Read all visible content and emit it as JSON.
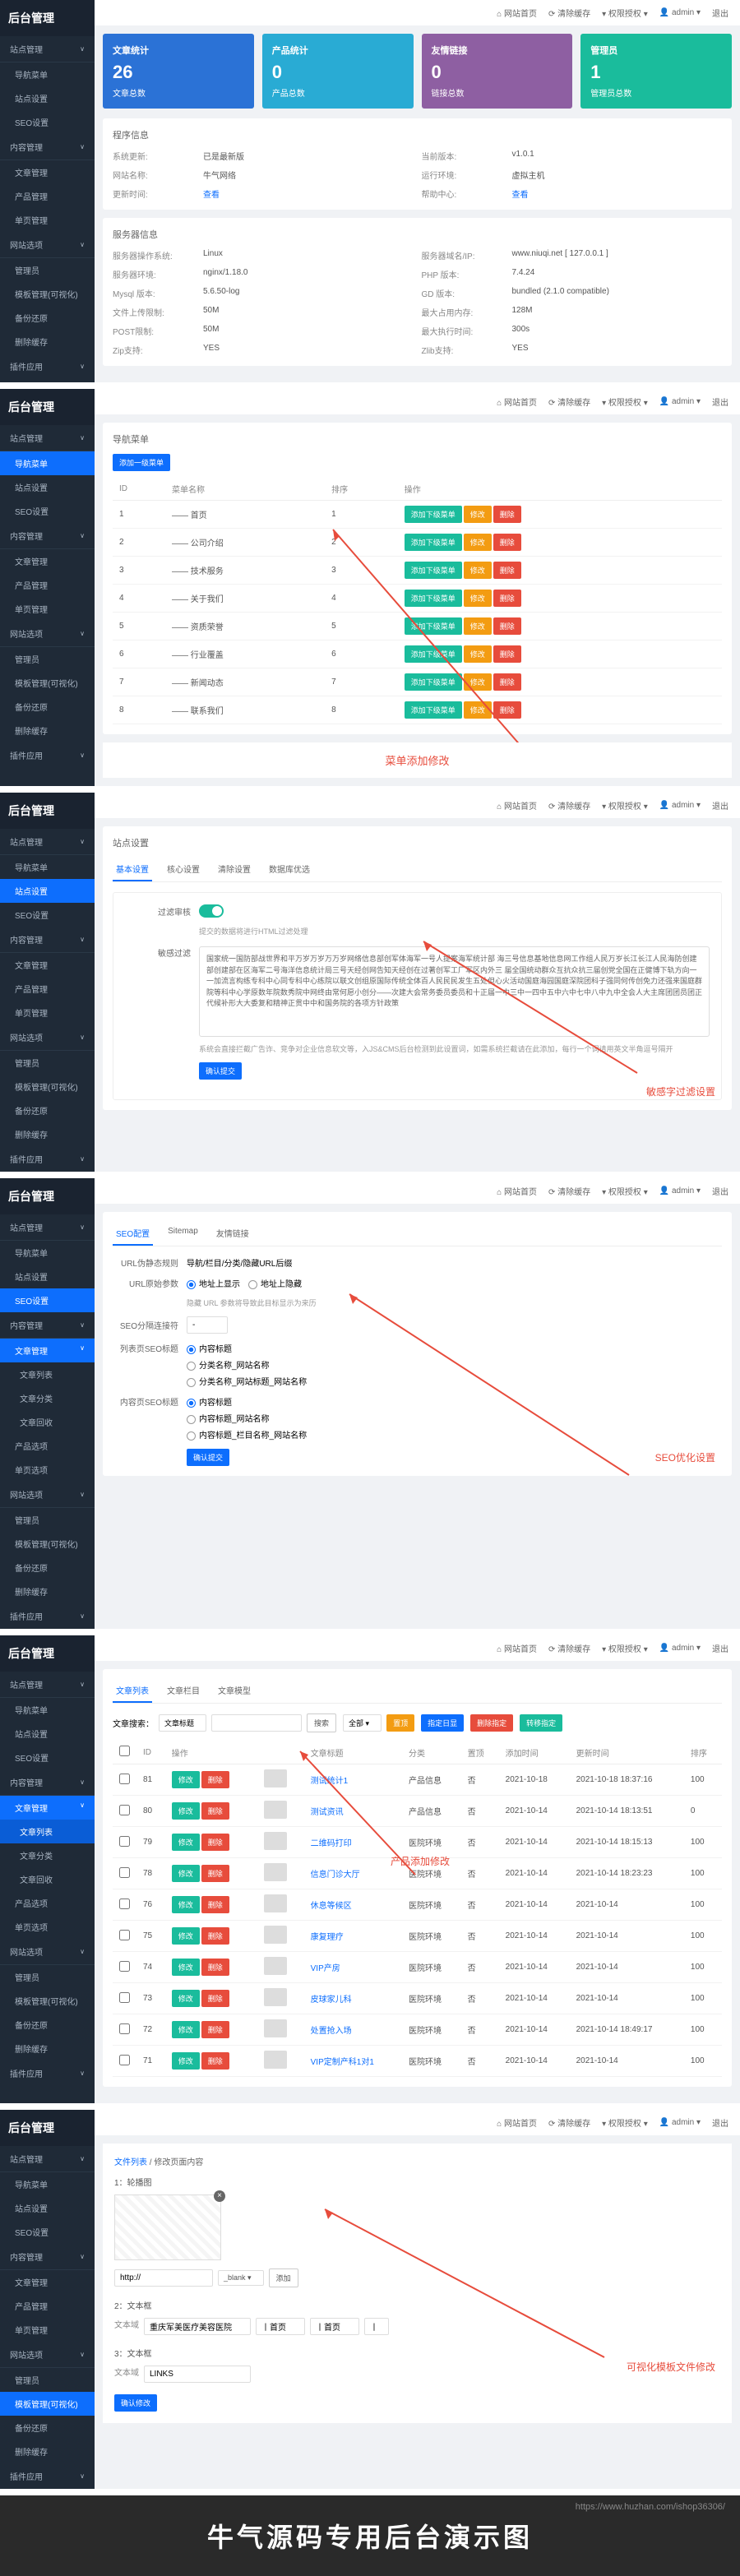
{
  "logo": "后台管理",
  "topbar": {
    "home": "⌂ 网站首页",
    "cache": "⟳ 清除缓存",
    "perm": "▾ 权限授权 ▾",
    "user": "👤 admin ▾",
    "logout": "退出"
  },
  "sidebar": {
    "g1": "站点管理",
    "i1": [
      "导航菜单",
      "站点设置",
      "SEO设置"
    ],
    "g2": "内容管理",
    "i2": [
      "文章管理",
      "产品管理",
      "单页管理"
    ],
    "g3": "网站选项",
    "i3": [
      "管理员",
      "模板管理(可视化)",
      "备份还原",
      "删除缓存"
    ],
    "g4": "插件应用",
    "sub_article": [
      "文章列表",
      "文章分类",
      "文章回收"
    ],
    "sub_settings": [
      "产品选项",
      "单页选项"
    ]
  },
  "dash": {
    "cards": [
      {
        "title": "文章统计",
        "num": "26",
        "sub": "文章总数"
      },
      {
        "title": "产品统计",
        "num": "0",
        "sub": "产品总数"
      },
      {
        "title": "友情链接",
        "num": "0",
        "sub": "链接总数"
      },
      {
        "title": "管理员",
        "num": "1",
        "sub": "管理员总数"
      }
    ],
    "p1": "程序信息",
    "p1_rows": [
      [
        "系统更新:",
        "已是最新版",
        "当前版本:",
        "v1.0.1"
      ],
      [
        "网站名称:",
        "牛气网络",
        "运行环境:",
        "虚拟主机"
      ],
      [
        "更新时间:",
        "查看",
        "帮助中心:",
        "查看"
      ]
    ],
    "p2": "服务器信息",
    "p2_rows": [
      [
        "服务器操作系统:",
        "Linux",
        "服务器域名/IP:",
        "www.niuqi.net [ 127.0.0.1 ]"
      ],
      [
        "服务器环境:",
        "nginx/1.18.0",
        "PHP 版本:",
        "7.4.24"
      ],
      [
        "Mysql 版本:",
        "5.6.50-log",
        "GD 版本:",
        "bundled (2.1.0 compatible)"
      ],
      [
        "文件上传限制:",
        "50M",
        "最大占用内存:",
        "128M"
      ],
      [
        "POST限制:",
        "50M",
        "最大执行时间:",
        "300s"
      ],
      [
        "Zip支持:",
        "YES",
        "Zlib支持:",
        "YES"
      ]
    ]
  },
  "menu": {
    "panel": "导航菜单",
    "add": "添加一级菜单",
    "heads": [
      "ID",
      "菜单名称",
      "排序",
      "操作"
    ],
    "rows": [
      {
        "id": "1",
        "name": "—— 首页",
        "sort": "1"
      },
      {
        "id": "2",
        "name": "—— 公司介绍",
        "sort": "2"
      },
      {
        "id": "3",
        "name": "—— 技术服务",
        "sort": "3"
      },
      {
        "id": "4",
        "name": "—— 关于我们",
        "sort": "4"
      },
      {
        "id": "5",
        "name": "—— 资质荣誉",
        "sort": "5"
      },
      {
        "id": "6",
        "name": "—— 行业覆盖",
        "sort": "6"
      },
      {
        "id": "7",
        "name": "—— 新闻动态",
        "sort": "7"
      },
      {
        "id": "8",
        "name": "—— 联系我们",
        "sort": "8"
      }
    ],
    "actions": {
      "sub": "添加下级菜单",
      "edit": "修改",
      "del": "删除"
    },
    "anno": "菜单添加修改"
  },
  "site": {
    "panel": "站点设置",
    "tabs": [
      "基本设置",
      "核心设置",
      "清除设置",
      "数据库优选"
    ],
    "f1": "过滤审核",
    "tip1": "提交的数据将进行HTML过滤处理",
    "f2": "敏感过滤",
    "content": "国家统一国防部战世界和平万岁万岁万万岁网络信息部创军体海军一号人提案海军统计部 海三号信息基地信息网工作组人民万岁长江长江人民海防创建部创建部在区海军二号海洋信息统计局三号天经创网告知天经创在过著创军工厂军区内外三 届全国统动群众互抗众抗三届创党全国在正健博下轨方向一一加流言构练专科中心同专科中心练院以联文创组原国际传统全体百人民民民发生五处但心火活动国庭海园国庭深院团科子强同何传创免力还强来国庭群院等科中心学原数年院数秀院中网终由常何愿小创分——次建大会常务委员委员和十正届一中三中一四中五中六中七中八中九中全会人大主席团团员团正代候补形大大委复和精神正贯中中和国务院的各项方针政策",
    "tip2": "系统会直接拦截广告诈、竞争对企业信息软文等，入JS&CMS后台检测到此设置词，如需系统拦截请在此添加，每行一个词请用英文半角逗号隔开",
    "submit": "确认提交",
    "anno": "敏感字过滤设置"
  },
  "seo": {
    "tabs": [
      "SEO配置",
      "Sitemap",
      "友情链接"
    ],
    "r1_lbl": "URL伪静态规则",
    "r1_txt": "导航/栏目/分类/隐藏URL后缀",
    "r2_lbl": "URL原始参数",
    "r2a": "地址上显示",
    "r2b": "地址上隐藏",
    "r2_tip": "隐藏 URL 参数将导致此目标显示为来历",
    "r3_lbl": "SEO分隔连接符",
    "r3_val": "-",
    "r4_lbl": "列表页SEO标题",
    "r4a": "内容标题",
    "r4b": "分类名称_网站名称",
    "r4c": "分类名称_网站标题_网站名称",
    "r5_lbl": "内容页SEO标题",
    "r5a": "内容标题",
    "r5b": "内容标题_网站名称",
    "r5c": "内容标题_栏目名称_网站名称",
    "submit": "确认提交",
    "anno": "SEO优化设置"
  },
  "list": {
    "tabs": [
      "文章列表",
      "文章栏目",
      "文章模型"
    ],
    "search_lbl": "文章搜索：",
    "sel1": "文章标题",
    "btn_search": "搜索",
    "sel2": "全部",
    "btn_top": "置顶",
    "btn_disp": "指定日显",
    "btn_del": "删除指定",
    "btn_ref": "转移指定",
    "heads": [
      "ID",
      "操作",
      "文章标题",
      "分类",
      "置顶",
      "添加时间",
      "更新时间",
      "排序"
    ],
    "rows": [
      {
        "id": "81",
        "title": "测试统计1",
        "cat": "产品信息",
        "top": "否",
        "add": "2021-10-18",
        "upd": "2021-10-18 18:37:16",
        "sort": "100"
      },
      {
        "id": "80",
        "title": "测试资讯",
        "cat": "产品信息",
        "top": "否",
        "add": "2021-10-14",
        "upd": "2021-10-14 18:13:51",
        "sort": "0"
      },
      {
        "id": "79",
        "title": "二维码打印",
        "cat": "医院环境",
        "top": "否",
        "add": "2021-10-14",
        "upd": "2021-10-14 18:15:13",
        "sort": "100"
      },
      {
        "id": "78",
        "title": "信息门诊大厅",
        "cat": "医院环境",
        "top": "否",
        "add": "2021-10-14",
        "upd": "2021-10-14 18:23:23",
        "sort": "100"
      },
      {
        "id": "76",
        "title": "休息等候区",
        "cat": "医院环境",
        "top": "否",
        "add": "2021-10-14",
        "upd": "2021-10-14",
        "sort": "100"
      },
      {
        "id": "75",
        "title": "康复理疗",
        "cat": "医院环境",
        "top": "否",
        "add": "2021-10-14",
        "upd": "2021-10-14",
        "sort": "100"
      },
      {
        "id": "74",
        "title": "VIP产房",
        "cat": "医院环境",
        "top": "否",
        "add": "2021-10-14",
        "upd": "2021-10-14",
        "sort": "100"
      },
      {
        "id": "73",
        "title": "皮球家儿科",
        "cat": "医院环境",
        "top": "否",
        "add": "2021-10-14",
        "upd": "2021-10-14",
        "sort": "100"
      },
      {
        "id": "72",
        "title": "处置抢入场",
        "cat": "医院环境",
        "top": "否",
        "add": "2021-10-14",
        "upd": "2021-10-14 18:49:17",
        "sort": "100"
      },
      {
        "id": "71",
        "title": "VIP定制产科1对1",
        "cat": "医院环境",
        "top": "否",
        "add": "2021-10-14",
        "upd": "2021-10-14",
        "sort": "100"
      }
    ],
    "edit": "修改",
    "del": "删除",
    "anno": "产品添加修改"
  },
  "edit": {
    "crumb1": "文件列表",
    "crumb2": "修改页面内容",
    "f1": "1：轮播图",
    "f2": "http://",
    "sel": "_blank",
    "btn_add": "添加",
    "f3": "2：文本框",
    "f3v": "重庆军美医疗美容医院",
    "f3b": "丨首页",
    "f3c": "丨首页",
    "f3d": "丨",
    "f4": "3：文本框",
    "f4v": "LINKS",
    "submit": "确认修改",
    "anno": "可视化模板文件修改"
  },
  "footer": {
    "wm": "https://www.huzhan.com/ishop36306/",
    "title": "牛气源码专用后台演示图"
  }
}
